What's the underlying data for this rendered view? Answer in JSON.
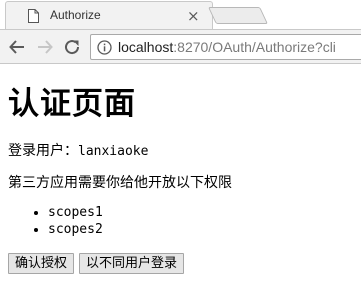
{
  "browser": {
    "tab_title": "Authorize",
    "tab_close": "×",
    "url_host": "localhost",
    "url_path": ":8270/OAuth/Authorize?cli",
    "icons": {
      "favicon": "page-icon",
      "close": "close-icon",
      "back": "back-arrow-icon",
      "forward": "forward-arrow-icon",
      "reload": "reload-icon",
      "info": "info-icon"
    }
  },
  "page": {
    "title": "认证页面",
    "user_label": "登录用户：",
    "user_name": "lanxiaoke",
    "permission_text": "第三方应用需要你给他开放以下权限",
    "scopes": [
      "scopes1",
      "scopes2"
    ],
    "buttons": {
      "confirm": "确认授权",
      "switch_user": "以不同用户登录"
    }
  }
}
